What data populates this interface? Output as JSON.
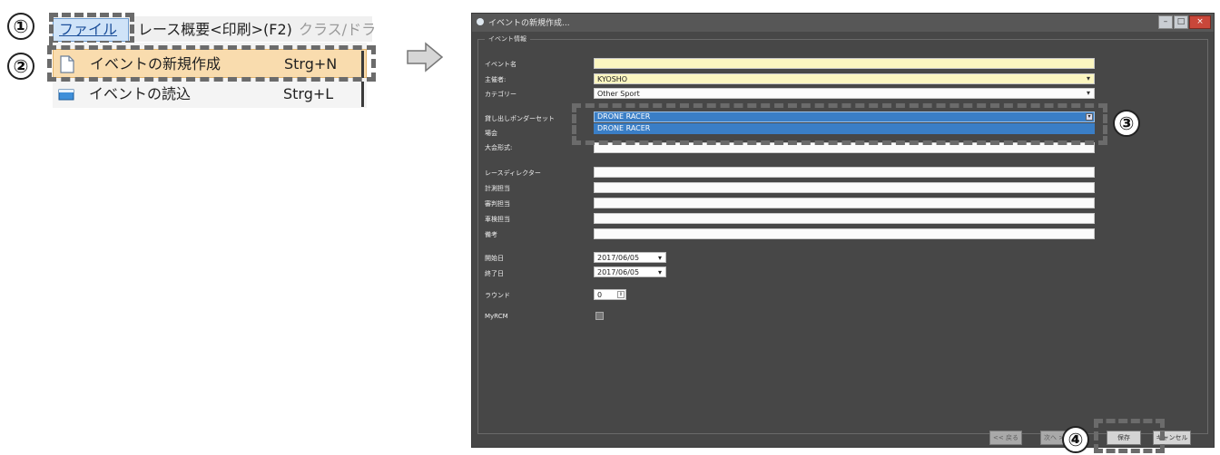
{
  "steps": [
    "①",
    "②",
    "③",
    "④"
  ],
  "menu": {
    "file_label": "ファイル",
    "top_items": [
      "レース概要<印刷>(F2)",
      "クラス/ドラ"
    ],
    "items": [
      {
        "label": "イベントの新規作成",
        "shortcut": "Strg+N",
        "icon": "new-document-icon"
      },
      {
        "label": "イベントの読込",
        "shortcut": "Strg+L",
        "icon": "open-folder-icon"
      }
    ]
  },
  "dialog": {
    "title": "イベントの新規作成...",
    "window_buttons": [
      "–",
      "□",
      "×"
    ],
    "group_label": "イベント情報",
    "fields": {
      "event_name": {
        "label": "イベント名",
        "value": ""
      },
      "organizer": {
        "label": "主催者:",
        "value": "KYOSHO"
      },
      "category": {
        "label": "カテゴリー",
        "value": "Other Sport"
      },
      "preset": {
        "label": "貸し出しポンダーセット",
        "value": "DRONE RACER",
        "options": [
          "DRONE RACER"
        ]
      },
      "venue": {
        "label": "場会",
        "value": ""
      },
      "format": {
        "label": "大会形式:",
        "value": ""
      },
      "race_director": {
        "label": "レースディレクター",
        "value": ""
      },
      "timing": {
        "label": "計測担当",
        "value": ""
      },
      "judge": {
        "label": "審判担当",
        "value": ""
      },
      "vehicle": {
        "label": "車検担当",
        "value": ""
      },
      "remarks": {
        "label": "備考",
        "value": ""
      },
      "start_date": {
        "label": "開始日",
        "value": "2017/06/05"
      },
      "end_date": {
        "label": "終了日",
        "value": "2017/06/05"
      },
      "rounds": {
        "label": "ラウンド",
        "value": "0"
      },
      "myrcm": {
        "label": "MyRCM",
        "checked": false
      }
    },
    "buttons": {
      "back": "<< 戻る",
      "next": "次へ >>",
      "save": "保存",
      "cancel": "キャンセル"
    }
  },
  "colors": {
    "dialog_bg": "#474747",
    "highlight": "#3a7ec6",
    "menu_hover": "#f9dcae"
  }
}
